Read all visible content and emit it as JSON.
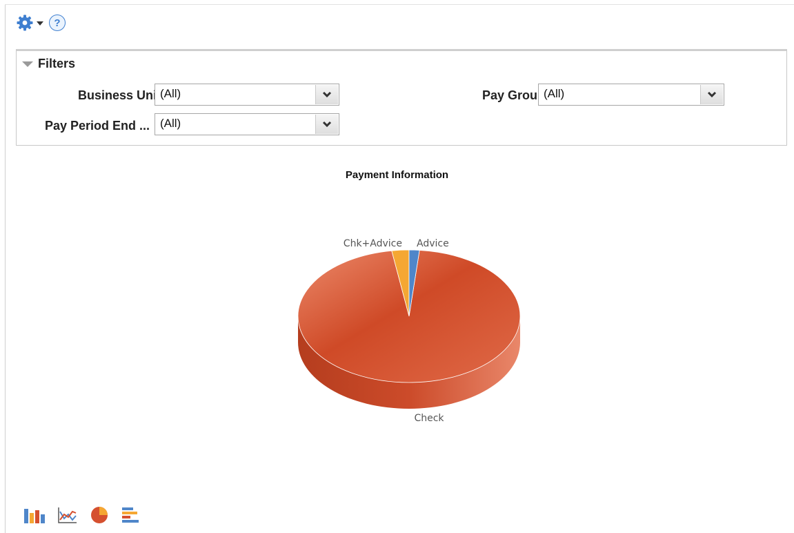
{
  "toolbar": {
    "settings_icon": "gear-icon",
    "menu_icon": "chevron-down-icon",
    "help_icon": "help-icon",
    "help_glyph": "?"
  },
  "filters": {
    "title": "Filters",
    "fields": [
      {
        "label": "Business Unit",
        "value": "(All)"
      },
      {
        "label": "Pay Group",
        "value": "(All)"
      },
      {
        "label": "Pay Period End ...",
        "value": "(All)"
      }
    ]
  },
  "chart_data": {
    "type": "pie",
    "title": "Payment Information",
    "slices": [
      {
        "label": "Check",
        "value": 96,
        "color": "#d5502f"
      },
      {
        "label": "Chk+Advice",
        "value": 2.5,
        "color": "#f5a733"
      },
      {
        "label": "Advice",
        "value": 1.5,
        "color": "#4f86c9"
      }
    ]
  },
  "chart_types": [
    "bar-chart-icon",
    "line-chart-icon",
    "pie-chart-icon",
    "horizontal-bar-chart-icon"
  ]
}
